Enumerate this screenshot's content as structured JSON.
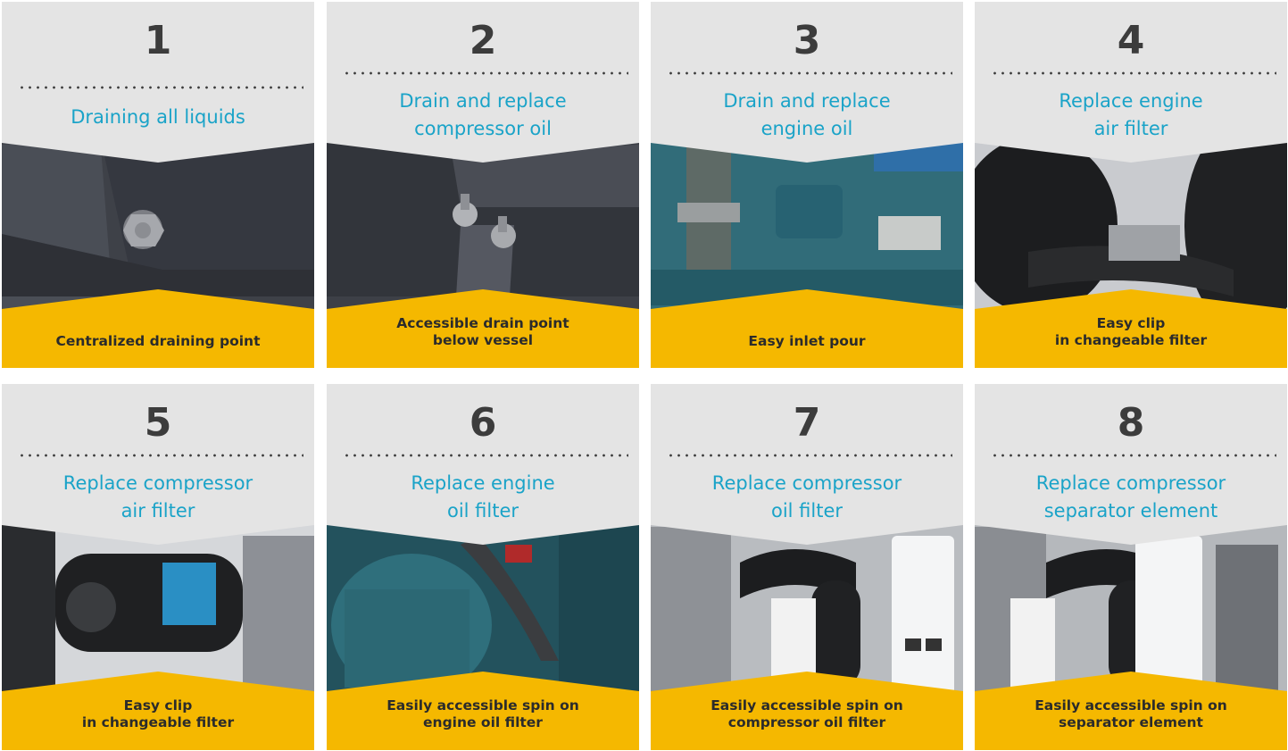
{
  "colors": {
    "header_bg": "#e4e4e4",
    "number": "#3c3c3c",
    "title": "#1aa3c8",
    "footer_bg": "#f5b800",
    "caption": "#2b2b2b"
  },
  "steps": [
    {
      "number": "1",
      "title": "Draining all liquids",
      "caption": "Centralized draining point",
      "photo_icon": "drain-plug-photo"
    },
    {
      "number": "2",
      "title": "Drain and replace\ncompressor oil",
      "caption": "Accessible drain point\nbelow vessel",
      "photo_icon": "vessel-drain-photo"
    },
    {
      "number": "3",
      "title": "Drain and replace\nengine oil",
      "caption": "Easy inlet pour",
      "photo_icon": "engine-oil-inlet-photo"
    },
    {
      "number": "4",
      "title": "Replace engine\nair filter",
      "caption": "Easy clip\nin changeable filter",
      "photo_icon": "engine-air-filter-photo"
    },
    {
      "number": "5",
      "title": "Replace compressor\nair filter",
      "caption": "Easy clip\nin changeable filter",
      "photo_icon": "compressor-air-filter-photo"
    },
    {
      "number": "6",
      "title": "Replace engine\noil filter",
      "caption": "Easily accessible spin on\nengine oil filter",
      "photo_icon": "engine-oil-filter-photo"
    },
    {
      "number": "7",
      "title": "Replace compressor\noil filter",
      "caption": "Easily accessible spin on\ncompressor oil filter",
      "photo_icon": "compressor-oil-filter-photo"
    },
    {
      "number": "8",
      "title": "Replace compressor\nseparator element",
      "caption": "Easily accessible spin on\nseparator element",
      "photo_icon": "separator-element-photo"
    }
  ]
}
